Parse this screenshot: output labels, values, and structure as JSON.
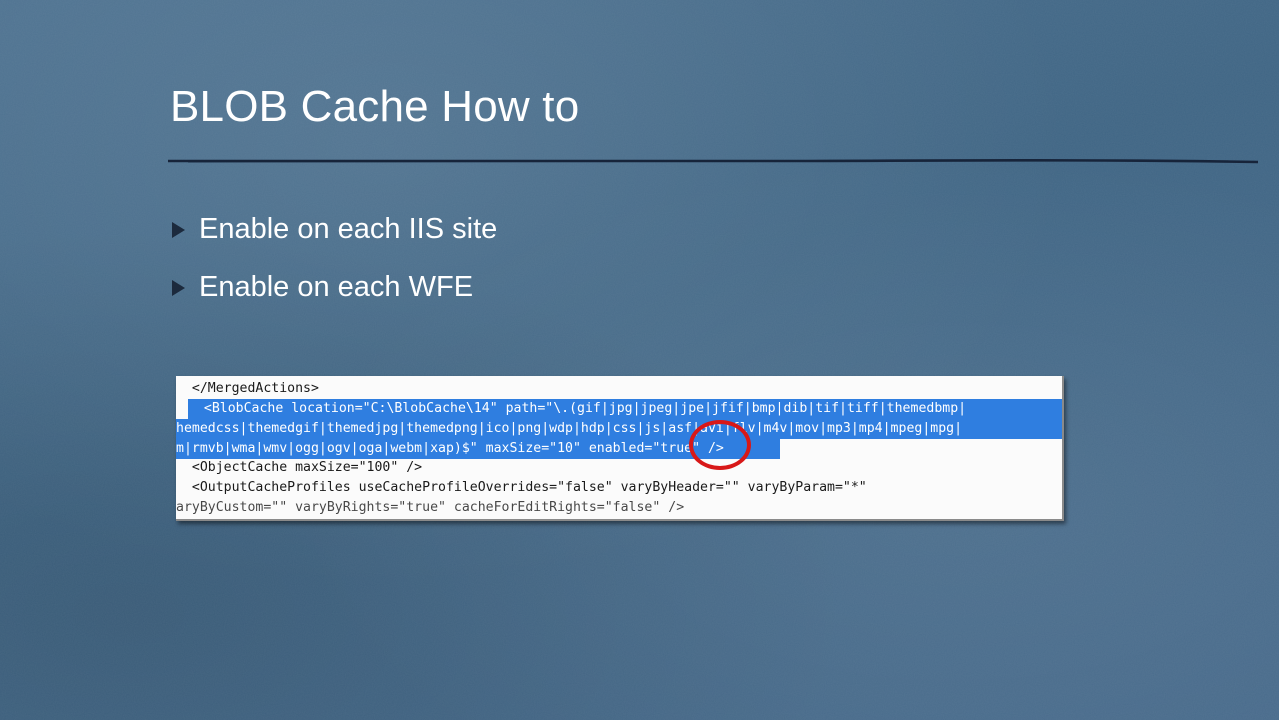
{
  "slide": {
    "title": "BLOB Cache How to",
    "bullets": [
      {
        "text": "Enable on each IIS site"
      },
      {
        "text": "Enable on each WFE"
      }
    ]
  },
  "code_screenshot": {
    "lines": [
      {
        "text": "                                                                                                   ",
        "highlighted": false
      },
      {
        "text": "  </MergedActions>",
        "highlighted": false
      },
      {
        "text": "  <BlobCache location=\"C:\\BlobCache\\14\" path=\"\\.(gif|jpg|jpeg|jpe|jfif|bmp|dib|tif|tiff|themedbmp|",
        "highlighted": true
      },
      {
        "text": "hemedcss|themedgif|themedjpg|themedpng|ico|png|wdp|hdp|css|js|asf|avi|flv|m4v|mov|mp3|mp4|mpeg|mpg|",
        "highlighted": true
      },
      {
        "text": "m|rmvb|wma|wmv|ogg|ogv|oga|webm|xap)$\" maxSize=\"10\" enabled=\"true\" />",
        "highlighted": true
      },
      {
        "text": "  <ObjectCache maxSize=\"100\" />",
        "highlighted": false
      },
      {
        "text": "  <OutputCacheProfiles useCacheProfileOverrides=\"false\" varyByHeader=\"\" varyByParam=\"*\"",
        "highlighted": false
      },
      {
        "text": "aryByCustom=\"\" varyByRights=\"true\" cacheForEditRights=\"false\" />",
        "highlighted": false
      }
    ],
    "annotation_color": "#d81818",
    "selection_color": "#2f7ee0"
  },
  "colors": {
    "background": "#46698a",
    "title_text": "#ffffff",
    "bullet_arrow": "#1c2a3d",
    "divider": "#17243a"
  }
}
